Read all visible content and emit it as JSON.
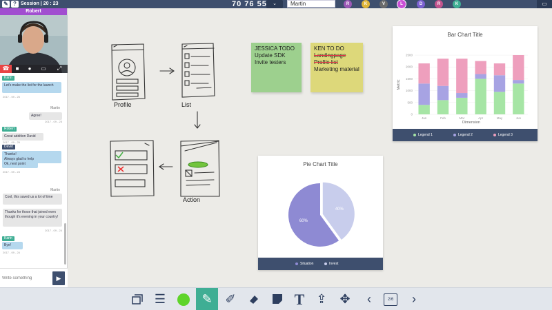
{
  "topbar": {
    "session": "Session | 20 : 23",
    "code": "70 76 55",
    "name_value": "Martin",
    "participants": [
      {
        "initial": "R",
        "color": "#9b59b6",
        "selected": false
      },
      {
        "initial": "K",
        "color": "#e0b63a",
        "selected": false
      },
      {
        "initial": "V",
        "color": "#6b6b6b",
        "selected": false
      },
      {
        "initial": "L",
        "color": "#c94fd6",
        "selected": true
      },
      {
        "initial": "D",
        "color": "#7b61d1",
        "selected": false
      },
      {
        "initial": "R",
        "color": "#c2548e",
        "selected": false
      },
      {
        "initial": "K",
        "color": "#3fae94",
        "selected": false
      }
    ]
  },
  "video": {
    "user_name": "Robert"
  },
  "chat": {
    "messages": [
      {
        "side": "l",
        "sender": "Karin",
        "sender_color": "#3fae94",
        "text": "Let's make the list for the launch",
        "time": "2017 - 09 - 25",
        "bg": "#b5d8ee"
      },
      {
        "side": "r",
        "sender": "Martin",
        "text": "Agree!",
        "time": "2017 - 09 - 25"
      },
      {
        "side": "l",
        "sender": "Robert",
        "sender_color": "#3fae94",
        "text": "Great addition David",
        "time": "2017 - 09 - 25",
        "bg": "#e6e6e6"
      },
      {
        "side": "l",
        "sender": "David",
        "sender_color": "#3e4f6e",
        "text": "Thanks!\nAlways glad to help",
        "time": "2017 - 09 - 24",
        "bg": "#b5d8ee"
      },
      {
        "side": "l",
        "sender": "",
        "text": "Ok, next point",
        "time": "2017 - 09 - 24",
        "bg": "#b5d8ee"
      },
      {
        "side": "r",
        "sender": "Martin",
        "text": "Cool, this saved us a lot of time",
        "time": "",
        "bg": "#e6e6e6"
      },
      {
        "side": "r",
        "sender": "",
        "text": "Thanks for those that joined even though it's evening in your country!",
        "time": "2017 - 09 - 24",
        "bg": "#e6e6e6"
      },
      {
        "side": "l",
        "sender": "Karin",
        "sender_color": "#3fae94",
        "text": "Bye!",
        "time": "2017 - 09 - 24",
        "bg": "#b5d8ee"
      }
    ],
    "composer_placeholder": "Write something"
  },
  "sketch": {
    "label_profile": "Profile",
    "label_list": "List",
    "label_action": "Action"
  },
  "sticky_notes": [
    {
      "color": "#9dd08e",
      "lines": [
        "JESSICA TODO",
        "Update SDK",
        "Invite testers"
      ]
    },
    {
      "color": "#ddd87a",
      "lines": [
        "KEN TO DO",
        "Landingpage",
        "Profile list",
        "Marketing material"
      ]
    }
  ],
  "chart_data": [
    {
      "type": "bar",
      "stacked": true,
      "title": "Bar Chart Title",
      "xlabel": "Dimension",
      "ylabel": "Metric",
      "categories": [
        "Jan",
        "Feb",
        "Mar",
        "Apr",
        "May",
        "Jun"
      ],
      "ylim": [
        0,
        2500
      ],
      "yticks": [
        0,
        500,
        1000,
        1500,
        2000,
        2500
      ],
      "series": [
        {
          "name": "Legend 1",
          "color": "#a6e5a5",
          "values": [
            400,
            600,
            700,
            1500,
            950,
            1300
          ]
        },
        {
          "name": "Legend 2",
          "color": "#a7a3e3",
          "values": [
            900,
            600,
            200,
            200,
            700,
            150
          ]
        },
        {
          "name": "Legend 3",
          "color": "#ee9fbd",
          "values": [
            850,
            1150,
            1450,
            550,
            500,
            1050
          ]
        }
      ],
      "legend_position": "bottom"
    },
    {
      "type": "pie",
      "title": "Pie Chart Title",
      "slices": [
        {
          "name": "Situation",
          "value": 60,
          "label": "60%",
          "color": "#8e8ad3"
        },
        {
          "name": "Invest",
          "value": 40,
          "label": "40%",
          "color": "#c8cdec"
        }
      ],
      "legend_position": "bottom"
    }
  ],
  "toolbar": {
    "page": "2/6"
  }
}
